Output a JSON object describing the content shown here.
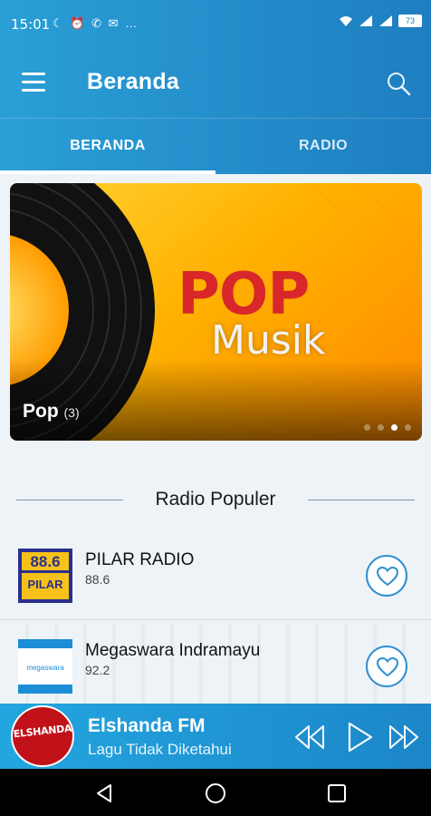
{
  "status_bar": {
    "time": "15:01",
    "left_icons": "☾ ⏰ ✆ ✉ …",
    "battery": "73"
  },
  "app_bar": {
    "title": "Beranda"
  },
  "tabs": [
    {
      "label": "BERANDA",
      "active": true
    },
    {
      "label": "RADIO",
      "active": false
    }
  ],
  "banner": {
    "headline": "POP",
    "subheadline": "Musik",
    "caption": "Pop",
    "count": "(3)",
    "dots_total": 4,
    "active_dot": 3
  },
  "section": {
    "title": "Radio Populer"
  },
  "radios": [
    {
      "name": "PILAR RADIO",
      "frequency": "88.6",
      "logo_text": "88.6",
      "logo_word": "PILAR"
    },
    {
      "name": "Megaswara Indramayu",
      "frequency": "92.2",
      "logo_text": "megaswara"
    }
  ],
  "player": {
    "station": "Elshanda FM",
    "song": "Lagu Tidak Diketahui",
    "logo_text": "ELSHANDA"
  },
  "colors": {
    "primary": "#1e7ec1",
    "accent_red": "#d8262a",
    "banner_yellow": "#ffb100"
  }
}
